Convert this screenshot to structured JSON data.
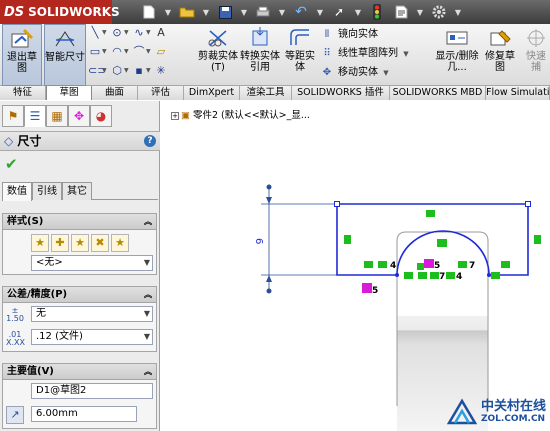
{
  "app": {
    "logo_brand": "DS",
    "logo_text": "SOLIDWORKS"
  },
  "quick_access": {
    "items": [
      {
        "icon": "new-document-icon"
      },
      {
        "icon": "open-folder-icon"
      },
      {
        "icon": "save-icon"
      },
      {
        "icon": "print-icon"
      },
      {
        "icon": "undo-icon"
      },
      {
        "icon": "select-cursor-icon"
      },
      {
        "icon": "rebuild-traffic-light-icon"
      },
      {
        "icon": "file-properties-icon"
      },
      {
        "icon": "options-gear-icon"
      }
    ]
  },
  "ribbon": {
    "exit_sketch": "退出草图",
    "smart_dimension": "智能尺寸",
    "trim_entities": "剪裁实体(T)",
    "convert_entities": "转换实体引用",
    "offset_entities": "等距实体",
    "mirror_entities": "镜向实体",
    "linear_pattern": "线性草图阵列",
    "move_entities": "移动实体",
    "display_delete_relations": "显示/删除几...",
    "repair_sketch": "修复草图",
    "quick_snaps": "快速捕"
  },
  "tabs": [
    "特征",
    "草图",
    "曲面",
    "评估",
    "DimXpert",
    "渲染工具",
    "SOLIDWORKS 插件",
    "SOLIDWORKS MBD",
    "Flow Simulati"
  ],
  "active_tab": "草图",
  "property_manager": {
    "title": "尺寸",
    "help": "?",
    "ok_check": "✔",
    "subtabs": [
      "数值",
      "引线",
      "其它"
    ],
    "style_group": {
      "title": "样式(S)",
      "favorite_value": "<无>"
    },
    "tolerance_group": {
      "title": "公差/精度(P)",
      "tolerance_type": "无",
      "precision": ".12 (文件)"
    },
    "primary_value_group": {
      "title": "主要值(V)",
      "name": "D1@草图2",
      "value": "6.00mm"
    }
  },
  "graphics": {
    "tree_path": "零件2  (默认<<默认>_显...",
    "dimension_value": "6",
    "relation_label_1": "5",
    "relation_label_2": "5",
    "relation_label_3": "4",
    "relation_label_4": "4",
    "relation_label_5": "7",
    "relation_label_6": "7",
    "relation_label_7": "4"
  },
  "watermark": {
    "line1": "中关村在线",
    "line2": "ZOL.COM.CN"
  },
  "colors": {
    "accent_red": "#b3271f",
    "sketch_blue": "#1f2ad9",
    "relation_green": "#1dbd1d",
    "relation_magenta": "#d81bd8"
  }
}
